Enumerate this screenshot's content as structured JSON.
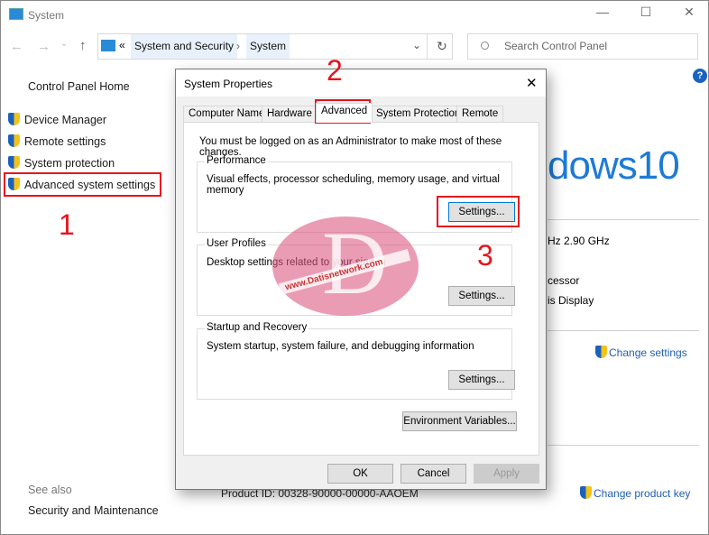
{
  "window": {
    "title": "System",
    "minimize": "—",
    "maximize": "☐",
    "close": "✕"
  },
  "nav": {
    "back": "←",
    "forward": "→",
    "recent": "⌄",
    "up": "↑",
    "overflow": "«",
    "crumbs": [
      "System and Security",
      "System"
    ],
    "crumb_sep": "›",
    "dropdown": "⌄",
    "refresh": "↻"
  },
  "search": {
    "placeholder": "Search Control Panel",
    "icon": "search-icon"
  },
  "help": "?",
  "sidebar": {
    "home": "Control Panel Home",
    "items": [
      {
        "label": "Device Manager"
      },
      {
        "label": "Remote settings"
      },
      {
        "label": "System protection"
      },
      {
        "label": "Advanced system settings"
      }
    ],
    "see_also": "See also",
    "see_also_items": [
      "Security and Maintenance"
    ]
  },
  "main": {
    "windows_logo": "dows10",
    "processor_speed_fragment": "Hz  2.90 GHz",
    "system_type_fragment": "cessor",
    "pen_touch_fragment": "is Display",
    "change_settings": "Change settings",
    "product_id": "Product ID:  00328-90000-00000-AAOEM",
    "change_product_key": "Change product key"
  },
  "annotations": {
    "step1": "1",
    "step2": "2",
    "step3": "3",
    "accent": "#e5141f"
  },
  "watermark": {
    "text": "www.Datisnetwork.com",
    "letter": "D"
  },
  "dialog": {
    "title": "System Properties",
    "close": "✕",
    "tabs": [
      "Computer Name",
      "Hardware",
      "Advanced",
      "System Protection",
      "Remote"
    ],
    "active_tab": "Advanced",
    "admin_note": "You must be logged on as an Administrator to make most of these changes.",
    "performance": {
      "label": "Performance",
      "desc": "Visual effects, processor scheduling, memory usage, and virtual memory",
      "button": "Settings..."
    },
    "profiles": {
      "label": "User Profiles",
      "desc": "Desktop settings related to your sign-in",
      "button": "Settings..."
    },
    "startup": {
      "label": "Startup and Recovery",
      "desc": "System startup, system failure, and debugging information",
      "button": "Settings..."
    },
    "env_button": "Environment Variables...",
    "ok": "OK",
    "cancel": "Cancel",
    "apply": "Apply"
  }
}
